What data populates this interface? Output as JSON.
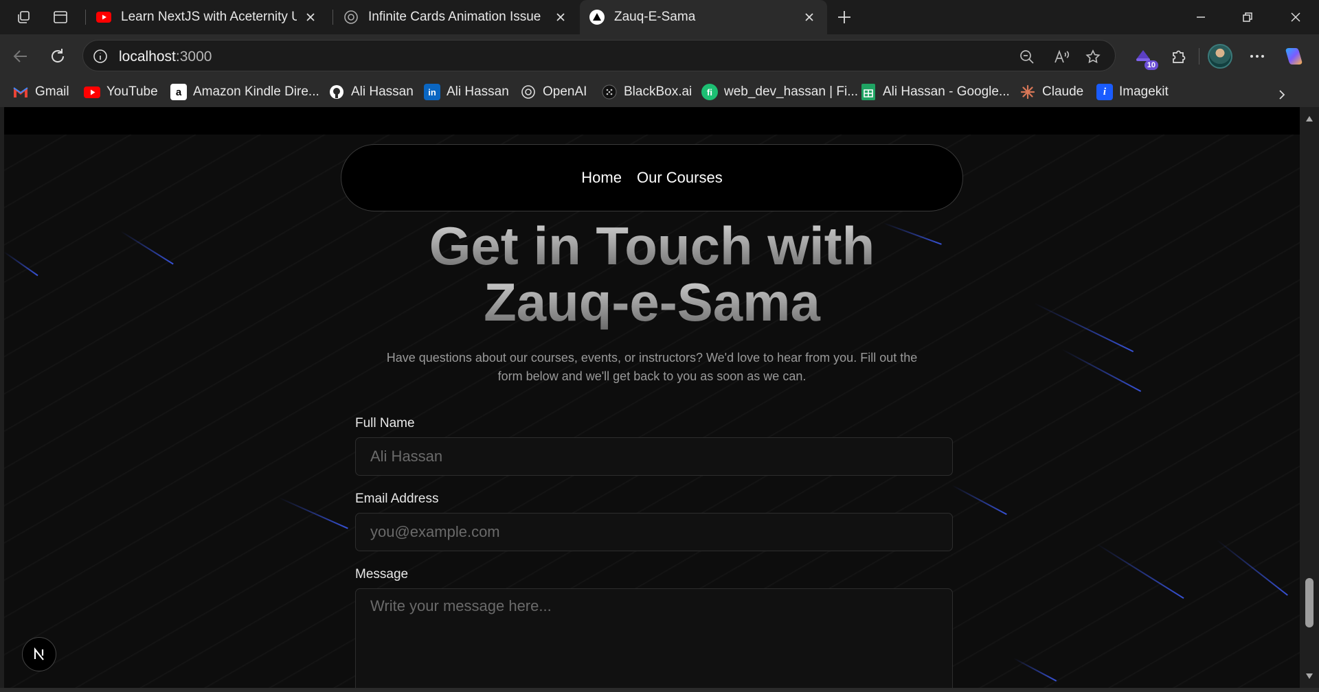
{
  "browser": {
    "tabs": [
      {
        "title": "Learn NextJS with Aceternity UI lil",
        "favicon": "youtube-icon"
      },
      {
        "title": "Infinite Cards Animation Issue",
        "favicon": "openai-icon"
      },
      {
        "title": "Zauq-E-Sama",
        "favicon": "vercel-triangle-icon",
        "active": true
      }
    ],
    "address": {
      "host": "localhost",
      "port": ":3000"
    },
    "extension_badge": "10",
    "bookmarks": [
      {
        "label": "Gmail",
        "icon": "gmail-icon"
      },
      {
        "label": "YouTube",
        "icon": "youtube-icon"
      },
      {
        "label": "Amazon Kindle Dire...",
        "icon": "amazon-icon"
      },
      {
        "label": "Ali Hassan",
        "icon": "github-icon"
      },
      {
        "label": "Ali Hassan",
        "icon": "linkedin-icon"
      },
      {
        "label": "OpenAI",
        "icon": "openai-icon"
      },
      {
        "label": "BlackBox.ai",
        "icon": "blackbox-icon"
      },
      {
        "label": "web_dev_hassan | Fi...",
        "icon": "fiverr-icon"
      },
      {
        "label": "Ali Hassan - Google...",
        "icon": "google-sheets-icon"
      },
      {
        "label": "Claude",
        "icon": "claude-icon"
      },
      {
        "label": "Imagekit",
        "icon": "imagekit-icon"
      }
    ]
  },
  "page": {
    "nav": {
      "home": "Home",
      "courses": "Our Courses"
    },
    "hero": {
      "line1": "Get in Touch with",
      "line2": "Zauq-e-Sama"
    },
    "subtitle": "Have questions about our courses, events, or instructors? We'd love to hear from you. Fill out the form below and we'll get back to you as soon as we can.",
    "form": {
      "name_label": "Full Name",
      "name_placeholder": "Ali Hassan",
      "email_label": "Email Address",
      "email_placeholder": "you@example.com",
      "message_label": "Message",
      "message_placeholder": "Write your message here..."
    },
    "dev_badge": "N"
  }
}
